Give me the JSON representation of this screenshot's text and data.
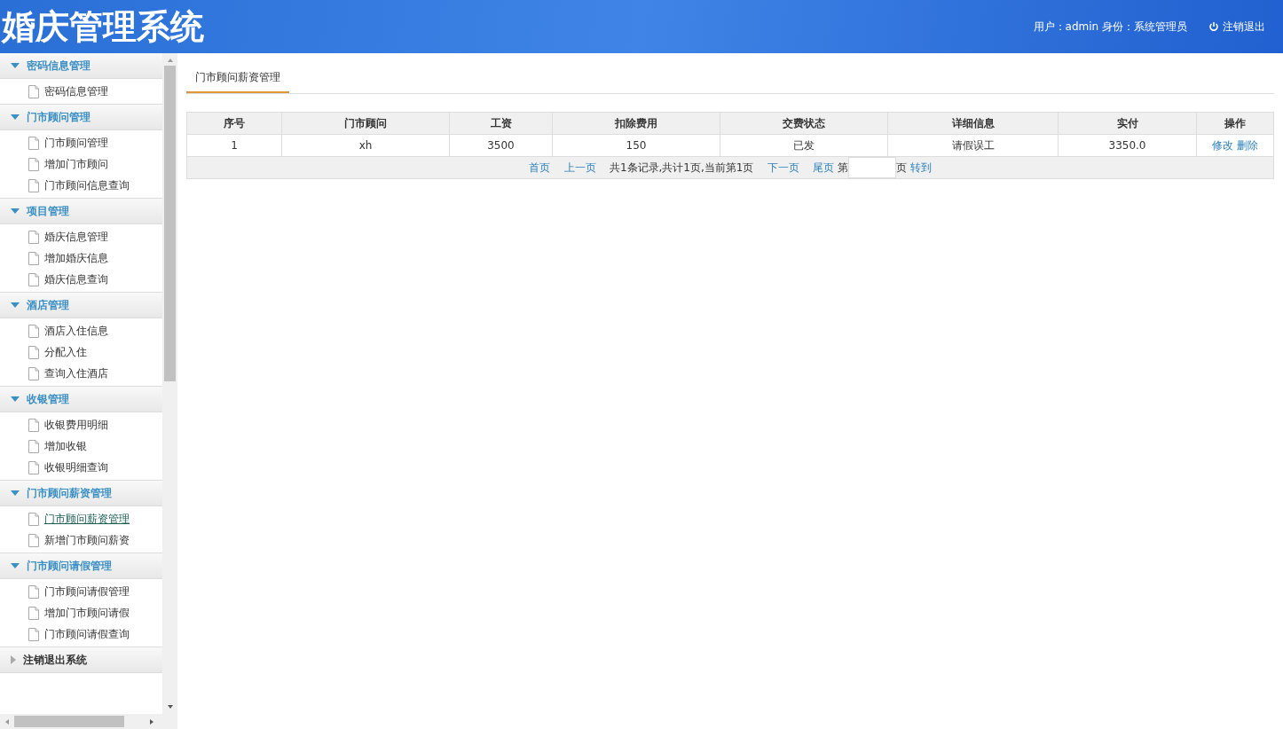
{
  "header": {
    "title": "婚庆管理系统",
    "user_info": "用户：admin 身份：系统管理员",
    "logout": "注销退出"
  },
  "sidebar": {
    "groups": [
      {
        "label": "密码信息管理",
        "expanded": true,
        "items": [
          {
            "label": "密码信息管理",
            "selected": false
          }
        ]
      },
      {
        "label": "门市顾问管理",
        "expanded": true,
        "items": [
          {
            "label": "门市顾问管理",
            "selected": false
          },
          {
            "label": "增加门市顾问",
            "selected": false
          },
          {
            "label": "门市顾问信息查询",
            "selected": false
          }
        ]
      },
      {
        "label": "项目管理",
        "expanded": true,
        "items": [
          {
            "label": "婚庆信息管理",
            "selected": false
          },
          {
            "label": "增加婚庆信息",
            "selected": false
          },
          {
            "label": "婚庆信息查询",
            "selected": false
          }
        ]
      },
      {
        "label": "酒店管理",
        "expanded": true,
        "items": [
          {
            "label": "酒店入住信息",
            "selected": false
          },
          {
            "label": "分配入住",
            "selected": false
          },
          {
            "label": "查询入住酒店",
            "selected": false
          }
        ]
      },
      {
        "label": "收银管理",
        "expanded": true,
        "items": [
          {
            "label": "收银费用明细",
            "selected": false
          },
          {
            "label": "增加收银",
            "selected": false
          },
          {
            "label": "收银明细查询",
            "selected": false
          }
        ]
      },
      {
        "label": "门市顾问薪资管理",
        "expanded": true,
        "items": [
          {
            "label": "门市顾问薪资管理",
            "selected": true
          },
          {
            "label": "新增门市顾问薪资",
            "selected": false
          }
        ]
      },
      {
        "label": "门市顾问请假管理",
        "expanded": true,
        "items": [
          {
            "label": "门市顾问请假管理",
            "selected": false
          },
          {
            "label": "增加门市顾问请假",
            "selected": false
          },
          {
            "label": "门市顾问请假查询",
            "selected": false
          }
        ]
      },
      {
        "label": "注销退出系统",
        "expanded": false
      }
    ]
  },
  "tabs": [
    {
      "label": "门市顾问薪资管理",
      "selected": true
    }
  ],
  "table": {
    "columns": [
      "序号",
      "门市顾问",
      "工资",
      "扣除费用",
      "交费状态",
      "详细信息",
      "实付",
      "操作"
    ],
    "rows": [
      {
        "cells": [
          "1",
          "xh",
          "3500",
          "150",
          "已发",
          "请假误工",
          "3350.0"
        ],
        "actions": [
          "修改",
          "删除"
        ]
      }
    ]
  },
  "pager": {
    "first": "首页",
    "prev": "上一页",
    "summary": "共1条记录,共计1页,当前第1页",
    "next": "下一页",
    "last": "尾页",
    "page_prefix": "第",
    "page_suffix": "页",
    "go": "转到"
  }
}
